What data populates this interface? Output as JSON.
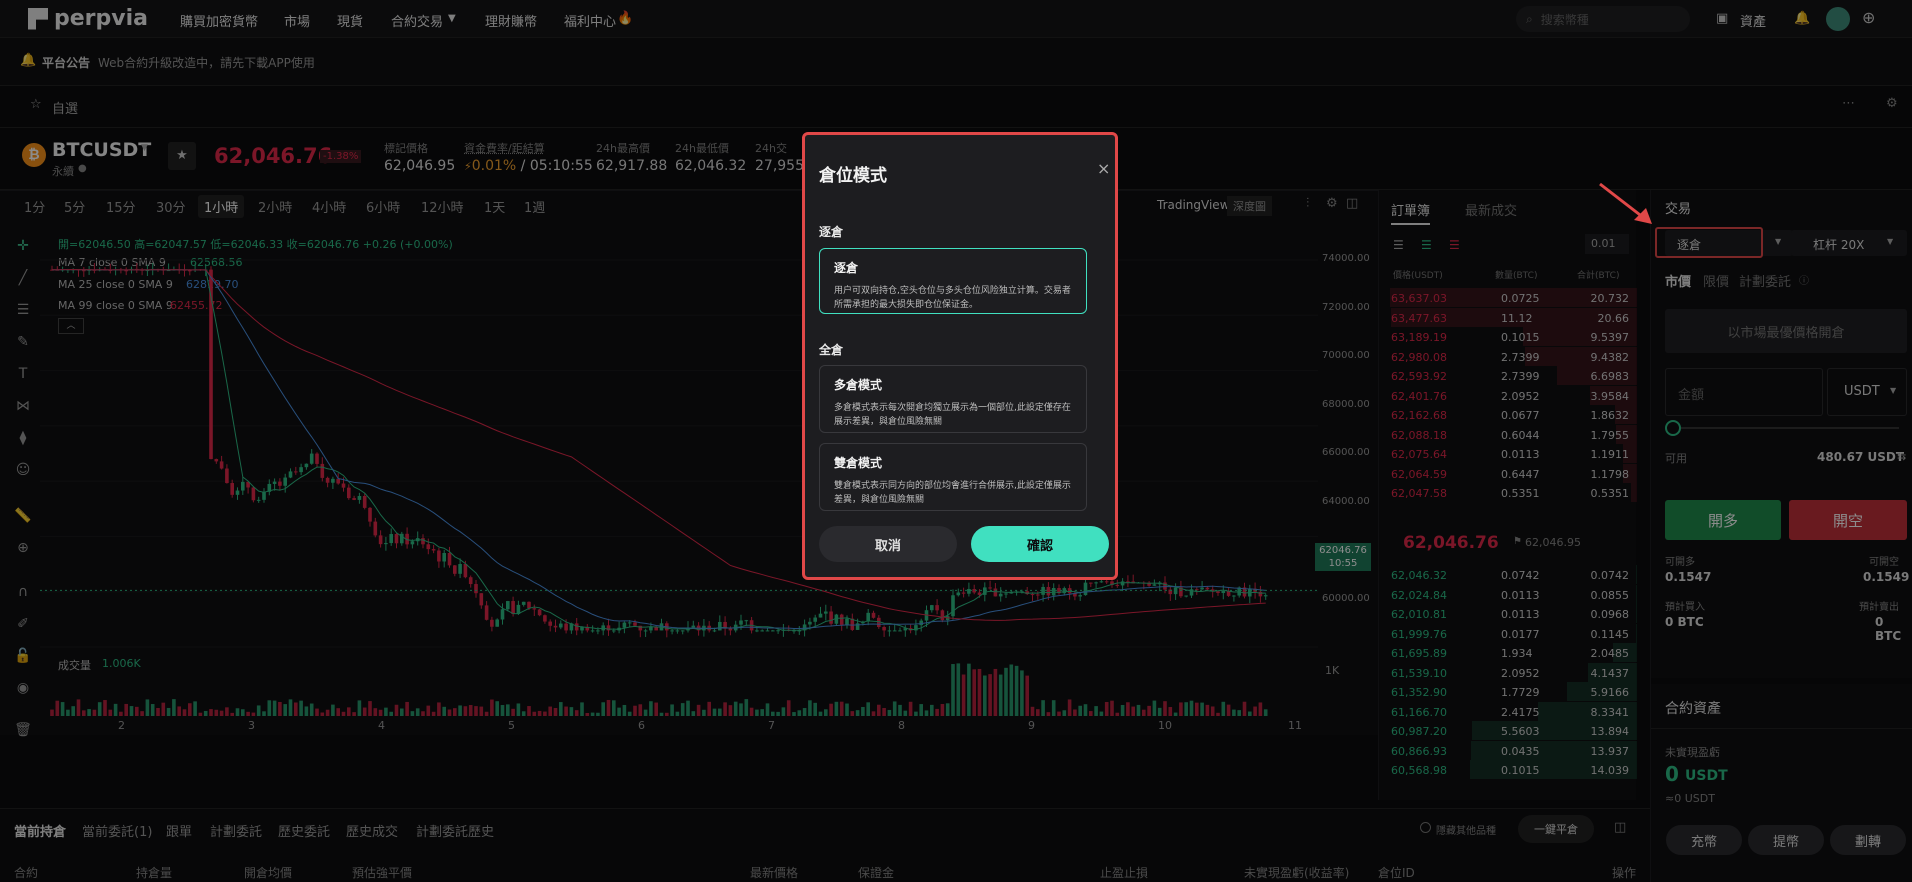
{
  "nav": {
    "logo": "perpvia",
    "items": [
      "購買加密貨幣",
      "市場",
      "現貨",
      "合約交易",
      "理財賺幣",
      "福利中心"
    ],
    "search_placeholder": "搜索幣種",
    "assets": "資產"
  },
  "announcement": {
    "title": "平台公告",
    "text": "Web合約升級改造中，請先下載APP使用"
  },
  "favorites": {
    "label": "自選"
  },
  "ticker": {
    "symbol": "BTCUSDT",
    "sub": "永續",
    "price": "62,046.76",
    "change": "-1.38%",
    "mark_label": "標記價格",
    "mark_value": "62,046.95",
    "funding_label": "資金費率/距結算",
    "funding_rate": "0.01%",
    "funding_sep": " / ",
    "funding_time": "05:10:55",
    "high_label": "24h最高價",
    "high_value": "62,917.88",
    "low_label": "24h最低價",
    "low_value": "62,046.32",
    "vol_label": "24h交",
    "vol_value": "27,955"
  },
  "chart": {
    "timeframes": [
      "1分",
      "5分",
      "15分",
      "30分",
      "1小時",
      "2小時",
      "4小時",
      "6小時",
      "12小時",
      "1天",
      "1週"
    ],
    "active_tf": "1小時",
    "tradingview": "TradingView",
    "depth": "深度圖",
    "ohlc": "開=62046.50  高=62047.57  低=62046.33  收=62046.76  +0.26 (+0.00%)",
    "ma7_label": "MA 7 close 0 SMA 9",
    "ma7_value": "62568.56",
    "ma25_label": "MA 25 close 0 SMA 9",
    "ma25_value": "62819.70",
    "ma99_label": "MA 99 close 0 SMA 9",
    "ma99_value": "62455.72",
    "price_axis": [
      "74000.00",
      "72000.00",
      "70000.00",
      "68000.00",
      "66000.00",
      "64000.00",
      "62000.00",
      "60000.00"
    ],
    "current_tag": "62046.76",
    "current_time": "10:55",
    "volume_label": "成交量",
    "volume_value": "1.006K",
    "volume_axis": "1K",
    "date_axis": [
      "2",
      "3",
      "4",
      "5",
      "6",
      "7",
      "8",
      "9",
      "10",
      "11"
    ],
    "colors": {
      "up": "#2ebd85",
      "down": "#e0294a",
      "ma7": "#2ebd85",
      "ma25": "#4a90e2",
      "ma99": "#e0294a"
    }
  },
  "orderbook": {
    "tabs": [
      "訂單簿",
      "最新成交"
    ],
    "precision": "0.01",
    "headers": [
      "價格(USDT)",
      "數量(BTC)",
      "合計(BTC)"
    ],
    "asks": [
      [
        "63,637.03",
        "0.0725",
        "20.732"
      ],
      [
        "63,477.63",
        "11.12",
        "20.66"
      ],
      [
        "63,189.19",
        "0.1015",
        "9.5397"
      ],
      [
        "62,980.08",
        "2.7399",
        "9.4382"
      ],
      [
        "62,593.92",
        "2.7399",
        "6.6983"
      ],
      [
        "62,401.76",
        "2.0952",
        "3.9584"
      ],
      [
        "62,162.68",
        "0.0677",
        "1.8632"
      ],
      [
        "62,088.18",
        "0.6044",
        "1.7955"
      ],
      [
        "62,075.64",
        "0.0113",
        "1.1911"
      ],
      [
        "62,064.59",
        "0.6447",
        "1.1798"
      ],
      [
        "62,047.58",
        "0.5351",
        "0.5351"
      ]
    ],
    "mid_price": "62,046.76",
    "mid_mark": "62,046.95",
    "bids": [
      [
        "62,046.32",
        "0.0742",
        "0.0742"
      ],
      [
        "62,024.84",
        "0.0113",
        "0.0855"
      ],
      [
        "62,010.81",
        "0.0113",
        "0.0968"
      ],
      [
        "61,999.76",
        "0.0177",
        "0.1145"
      ],
      [
        "61,695.89",
        "1.934",
        "2.0485"
      ],
      [
        "61,539.10",
        "2.0952",
        "4.1437"
      ],
      [
        "61,352.90",
        "1.7729",
        "5.9166"
      ],
      [
        "61,166.70",
        "2.4175",
        "8.3341"
      ],
      [
        "60,987.20",
        "5.5603",
        "13.894"
      ],
      [
        "60,866.93",
        "0.0435",
        "13.937"
      ],
      [
        "60,568.98",
        "0.1015",
        "14.039"
      ]
    ]
  },
  "trade": {
    "tab": "交易",
    "margin_mode": "逐倉",
    "leverage": "杠杆 20X",
    "order_types": [
      "市價",
      "限價",
      "計劃委託"
    ],
    "market_placeholder": "以市場最優價格開倉",
    "amount_placeholder": "金額",
    "unit": "USDT",
    "available_label": "可用",
    "available_value": "480.67 USDT",
    "open_long": "開多",
    "open_short": "開空",
    "can_open_long_label": "可開多",
    "can_open_long": "0.1547",
    "can_open_short_label": "可開空",
    "can_open_short": "0.1549",
    "est_buy_label": "預計買入",
    "est_buy": "0 BTC",
    "est_sell_label": "預計賣出",
    "est_sell": "0 BTC",
    "contract_assets": "合約資產",
    "unrealized_label": "未實現盈虧",
    "unrealized_value": "0",
    "unrealized_unit": "USDT",
    "unrealized_approx": "≈0 USDT",
    "deposit": "充幣",
    "withdraw": "提幣",
    "transfer": "劃轉",
    "colors": {
      "long": "#1f8a4c",
      "short": "#c0303a"
    }
  },
  "bottom": {
    "tabs": [
      "當前持倉",
      "當前委託(1)",
      "跟單",
      "計劃委託",
      "歷史委託",
      "歷史成交",
      "計劃委託歷史"
    ],
    "hide_other": "隱藏其他品種",
    "close_all": "一鍵平倉",
    "columns": [
      "合約",
      "持倉量",
      "開倉均價",
      "預估強平價",
      "最新價格",
      "保證金",
      "止盈止損",
      "未實現盈虧(收益率)",
      "倉位ID",
      "操作"
    ]
  },
  "modal": {
    "title": "倉位模式",
    "section_isolated": "逐倉",
    "isolated_title": "逐倉",
    "isolated_desc": "用户可双向持仓,空头仓位与多头仓位风险独立计算。交易者所需承担的最大损失即仓位保证金。",
    "section_cross": "全倉",
    "multi_title": "多倉模式",
    "multi_desc": "多倉模式表示每次開倉均獨立展示為一個部位,此設定僅存在展示差異，與倉位風險無關",
    "dual_title": "雙倉模式",
    "dual_desc": "雙倉模式表示同方向的部位均會進行合併展示,此設定僅展示差異，與倉位風險無關",
    "cancel": "取消",
    "confirm": "確認",
    "accent": "#40e0c0"
  }
}
